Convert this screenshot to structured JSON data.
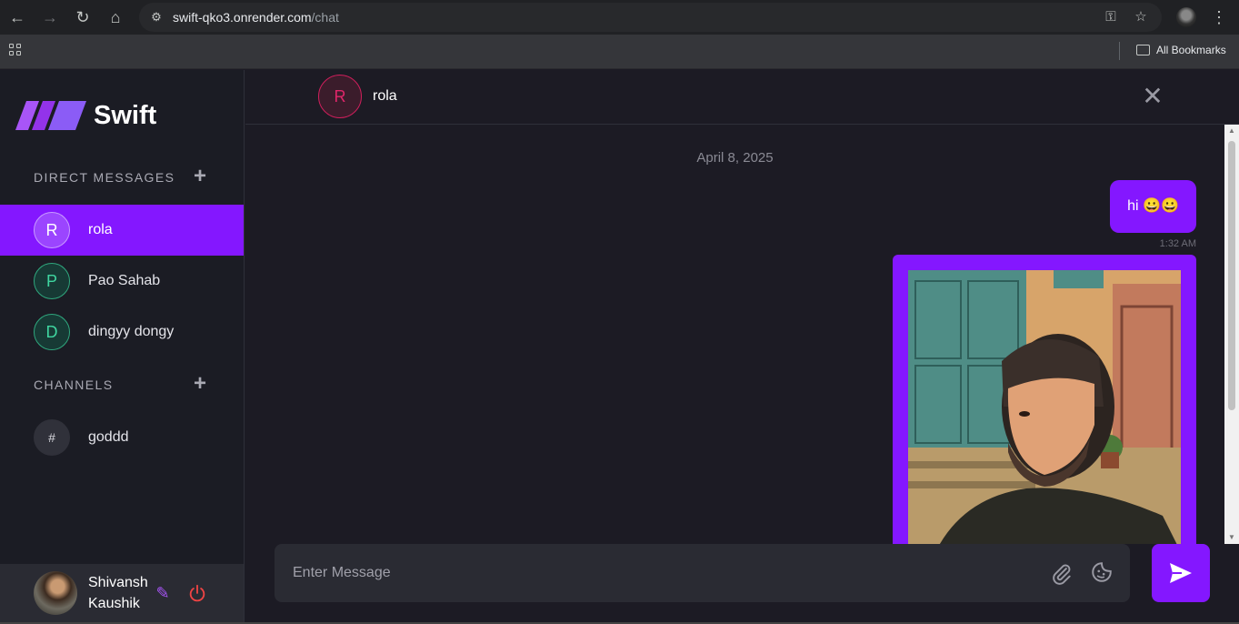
{
  "browser": {
    "url_host": "swift-qko3.onrender.com",
    "url_path": "/chat",
    "bookmarks_label": "All Bookmarks",
    "nav_icons": [
      "back-icon",
      "forward-icon",
      "reload-icon",
      "home-icon"
    ]
  },
  "sidebar": {
    "app_name": "Swift",
    "direct_messages_title": "DIRECT MESSAGES",
    "contacts": [
      {
        "initial": "R",
        "name": "rola",
        "active": true
      },
      {
        "initial": "P",
        "name": "Pao Sahab",
        "active": false
      },
      {
        "initial": "D",
        "name": "dingyy dongy",
        "active": false
      }
    ],
    "channels_title": "CHANNELS",
    "channels": [
      {
        "symbol": "#",
        "name": "goddd"
      }
    ],
    "user": {
      "name": "Shivansh Kaushik"
    }
  },
  "chat": {
    "peer_initial": "R",
    "peer_name": "rola",
    "date_separator": "April 8, 2025",
    "messages": [
      {
        "text": "hi 😀😀",
        "time": "1:32 AM",
        "own": true
      },
      {
        "type": "image",
        "own": true
      }
    ],
    "composer_placeholder": "Enter Message"
  },
  "colors": {
    "accent": "#8417ff",
    "sidebar_bg": "#1b1c24",
    "chat_bg": "#1c1b24",
    "dm_avatar": "#3fd6a0",
    "peer_avatar": "#e0266a",
    "logout": "#ef4444"
  }
}
